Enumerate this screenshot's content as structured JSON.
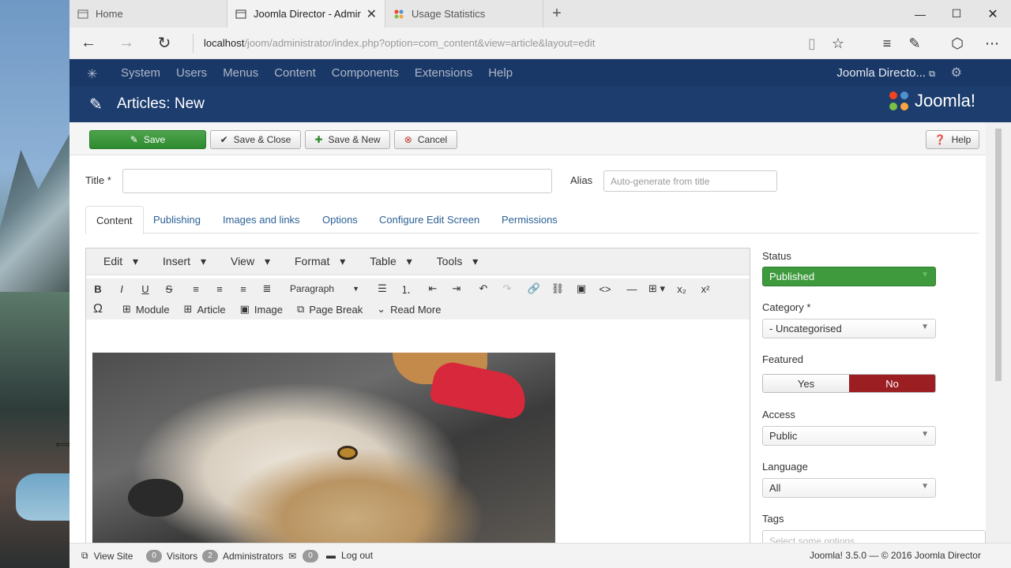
{
  "browser": {
    "tabs": [
      {
        "label": "Home"
      },
      {
        "label": "Joomla Director - Admir"
      },
      {
        "label": "Usage Statistics"
      }
    ],
    "new_tab": "+",
    "url_host": "localhost",
    "url_path": "/joom/administrator/index.php?option=com_content&view=article&layout=edit"
  },
  "jnav": {
    "items": [
      "System",
      "Users",
      "Menus",
      "Content",
      "Components",
      "Extensions",
      "Help"
    ],
    "site": "Joomla Directo..."
  },
  "header": {
    "title": "Articles: New",
    "brand": "Joomla!"
  },
  "toolbar": {
    "save": "Save",
    "save_close": "Save & Close",
    "save_new": "Save & New",
    "cancel": "Cancel",
    "help": "Help"
  },
  "form": {
    "title_label": "Title *",
    "title_value": "",
    "alias_label": "Alias",
    "alias_placeholder": "Auto-generate from title",
    "tabs": [
      "Content",
      "Publishing",
      "Images and links",
      "Options",
      "Configure Edit Screen",
      "Permissions"
    ]
  },
  "editor": {
    "menu": [
      "Edit",
      "Insert",
      "View",
      "Format",
      "Table",
      "Tools"
    ],
    "format_select": "Paragraph",
    "buttons": {
      "module": "Module",
      "article": "Article",
      "image": "Image",
      "page_break": "Page Break",
      "read_more": "Read More"
    }
  },
  "sidebar": {
    "status_label": "Status",
    "status_value": "Published",
    "category_label": "Category *",
    "category_value": "- Uncategorised",
    "featured_label": "Featured",
    "featured_yes": "Yes",
    "featured_no": "No",
    "access_label": "Access",
    "access_value": "Public",
    "language_label": "Language",
    "language_value": "All",
    "tags_label": "Tags",
    "tags_placeholder": "Select some options"
  },
  "statusbar": {
    "view_site": "View Site",
    "visitors_count": "0",
    "visitors": "Visitors",
    "admins_count": "2",
    "admins": "Administrators",
    "messages_count": "0",
    "logout": "Log out",
    "version": "Joomla! 3.5.0",
    "copyright": "— © 2016 Joomla Director"
  },
  "colors": {
    "nav_bg": "#1a3867",
    "header_bg": "#1c3d6e",
    "save_green": "#3f9a3e",
    "no_red": "#9b1e22",
    "link_blue": "#2d6195"
  }
}
